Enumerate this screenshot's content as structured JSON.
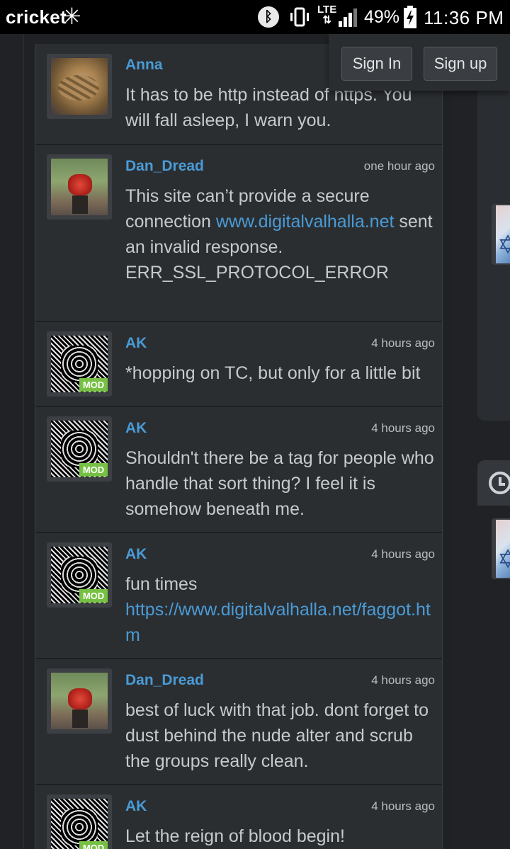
{
  "status_bar": {
    "carrier": "cricket",
    "network": "LTE",
    "battery": "49%",
    "time": "11:36 PM"
  },
  "auth": {
    "sign_in": "Sign In",
    "sign_up": "Sign up"
  },
  "posts": [
    {
      "author": "Anna",
      "time": "",
      "avatar": "cat-photo",
      "mod": false,
      "text": "It has to be http instead of https. You will fall asleep, I warn you.",
      "link": ""
    },
    {
      "author": "Dan_Dread",
      "time": "one hour ago",
      "avatar": "red-figure-photo",
      "mod": false,
      "text": "This site can’t provide a secure connection",
      "link": "www.digitalvalhalla.net",
      "text_after": "sent an invalid response. ERR_SSL_PROTOCOL_ERROR"
    },
    {
      "author": "AK",
      "time": "4 hours ago",
      "avatar": "pattern-mask",
      "mod": true,
      "text": "*hopping on TC, but only for a little bit",
      "link": ""
    },
    {
      "author": "AK",
      "time": "4 hours ago",
      "avatar": "pattern-mask",
      "mod": true,
      "text": "Shouldn't there be a tag for people who handle that sort thing? I feel it is somehow beneath me.",
      "link": ""
    },
    {
      "author": "AK",
      "time": "4 hours ago",
      "avatar": "pattern-mask",
      "mod": true,
      "text": "fun times",
      "link": "https://www.digitalvalhalla.net/faggot.htm"
    },
    {
      "author": "Dan_Dread",
      "time": "4 hours ago",
      "avatar": "red-figure-photo",
      "mod": false,
      "text": "best of luck with that job. dont forget to dust behind the nude alter and scrub the groups really clean.",
      "link": ""
    },
    {
      "author": "AK",
      "time": "4 hours ago",
      "avatar": "pattern-mask",
      "mod": true,
      "text": "Let the reign of blood begin!",
      "link": ""
    }
  ],
  "mod_label": "MOD"
}
